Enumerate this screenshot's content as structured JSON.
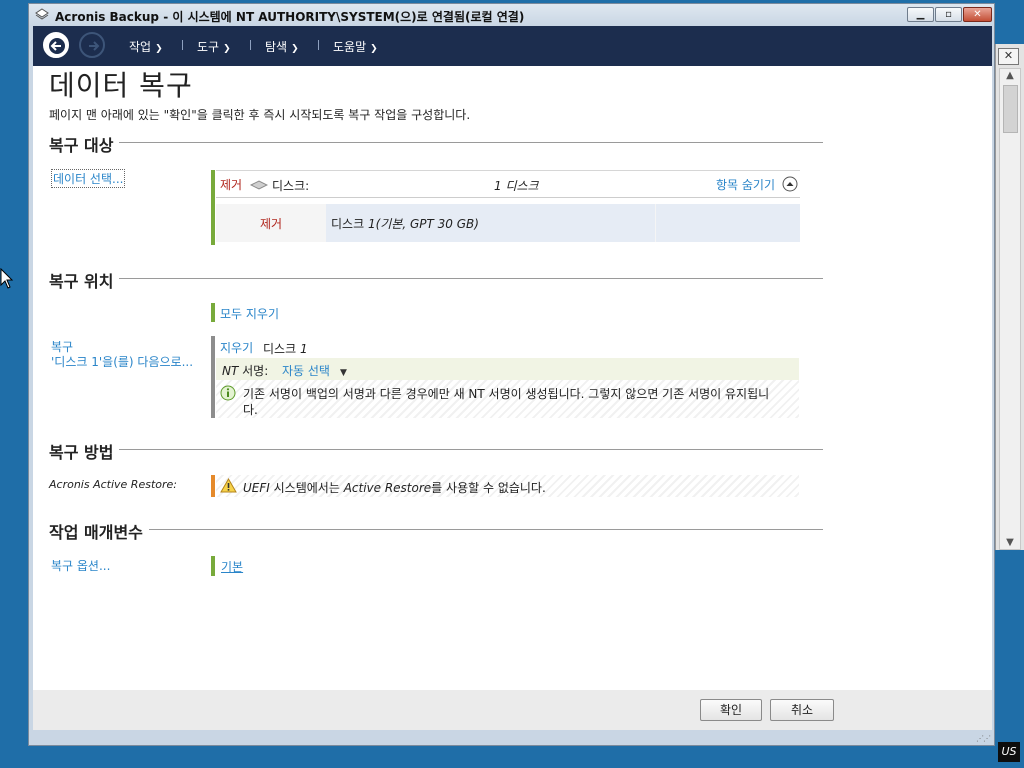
{
  "window": {
    "title": "Acronis Backup - 이 시스템에 NT AUTHORITY\\SYSTEM(으)로 연결됨(로컬 연결)"
  },
  "nav": {
    "menus": [
      "작업",
      "도구",
      "탐색",
      "도움말"
    ]
  },
  "page": {
    "title": "데이터 복구",
    "description": "페이지 맨 아래에 있는 \"확인\"을 클릭한 후 즉시 시작되도록 복구 작업을 구성합니다."
  },
  "recovery_target": {
    "heading": "복구 대상",
    "select_link": "데이터 선택...",
    "remove_label": "제거",
    "type_label": "디스크:",
    "count": "1 디스크",
    "hide_items": "항목 숨기기",
    "item": {
      "remove_label": "제거",
      "prefix": "디스크 ",
      "name": "1(기본, GPT 30 GB)"
    }
  },
  "recovery_location": {
    "heading": "복구 위치",
    "clear_all": "모두 지우기",
    "left_label_1": "복구",
    "left_label_2": "'디스크 1'을(를) 다음으로...",
    "clear_label": "지우기",
    "disk_prefix": "디스크 ",
    "disk_number": "1",
    "sig_prefix": "NT",
    "sig_label": " 서명:",
    "sig_value": "자동 선택",
    "info_line1": "기존 서명이 백업의 서명과 다른 경우에만 새 NT 서명이 생성됩니다. 그렇지 않으면 기존 서명이 유지됩니",
    "info_line2": "다."
  },
  "recovery_method": {
    "heading": "복구 방법",
    "active_restore_label": "Acronis Active Restore:",
    "warning_prefix": "UEFI",
    "warning_mid": " 시스템에서는 ",
    "warning_em": "Active Restore",
    "warning_suffix": "를 사용할 수 없습니다."
  },
  "task_params": {
    "heading": "작업 매개변수",
    "options_link": "복구 옵션...",
    "default_link": "기본"
  },
  "footer": {
    "ok": "확인",
    "cancel": "취소"
  },
  "desktop": {
    "language_indicator": "US"
  },
  "colors": {
    "navbar": "#1c2d4e",
    "link": "#2a85c9",
    "remove": "#b0261d",
    "accent_green": "#78aa3b",
    "warning": "#e58a2b"
  }
}
